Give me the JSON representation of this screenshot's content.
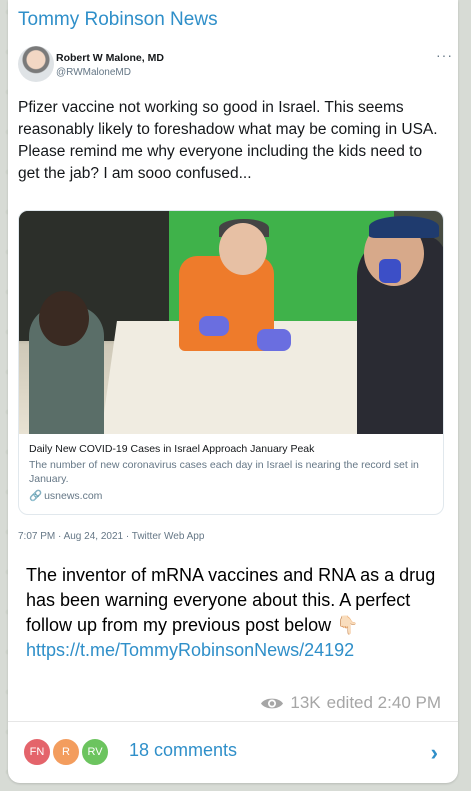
{
  "channel": {
    "title": "Tommy Robinson News"
  },
  "tweet": {
    "author_name": "Robert W Malone, MD",
    "author_handle": "@RWMaloneMD",
    "more_label": "···",
    "text": "Pfizer vaccine not working so good in Israel.  This seems reasonably likely to foreshadow what may be coming in USA.  Please remind me why everyone including the kids need to get the jab? I am sooo confused...",
    "card": {
      "title": "Daily New COVID-19 Cases in Israel Approach January Peak",
      "description": "The number of new coronavirus cases each day in Israel is nearing the record set in January.",
      "domain": "usnews.com",
      "link_icon": "🔗"
    },
    "meta": "7:07 PM · Aug 24, 2021 · Twitter Web App"
  },
  "message": {
    "text": "The inventor of mRNA vaccines and RNA as a drug has been warning everyone about this. A perfect follow up from my previous post below 👇🏻",
    "link": "https://t.me/TommyRobinsonNews/24192",
    "views": "13K",
    "edited": "edited 2:40 PM"
  },
  "comments": {
    "avatars": [
      {
        "initials": "FN",
        "color": "#e4646b"
      },
      {
        "initials": "R",
        "color": "#f39d5e"
      },
      {
        "initials": "RV",
        "color": "#6cc45f"
      }
    ],
    "label": "18 comments",
    "chevron": "›"
  }
}
